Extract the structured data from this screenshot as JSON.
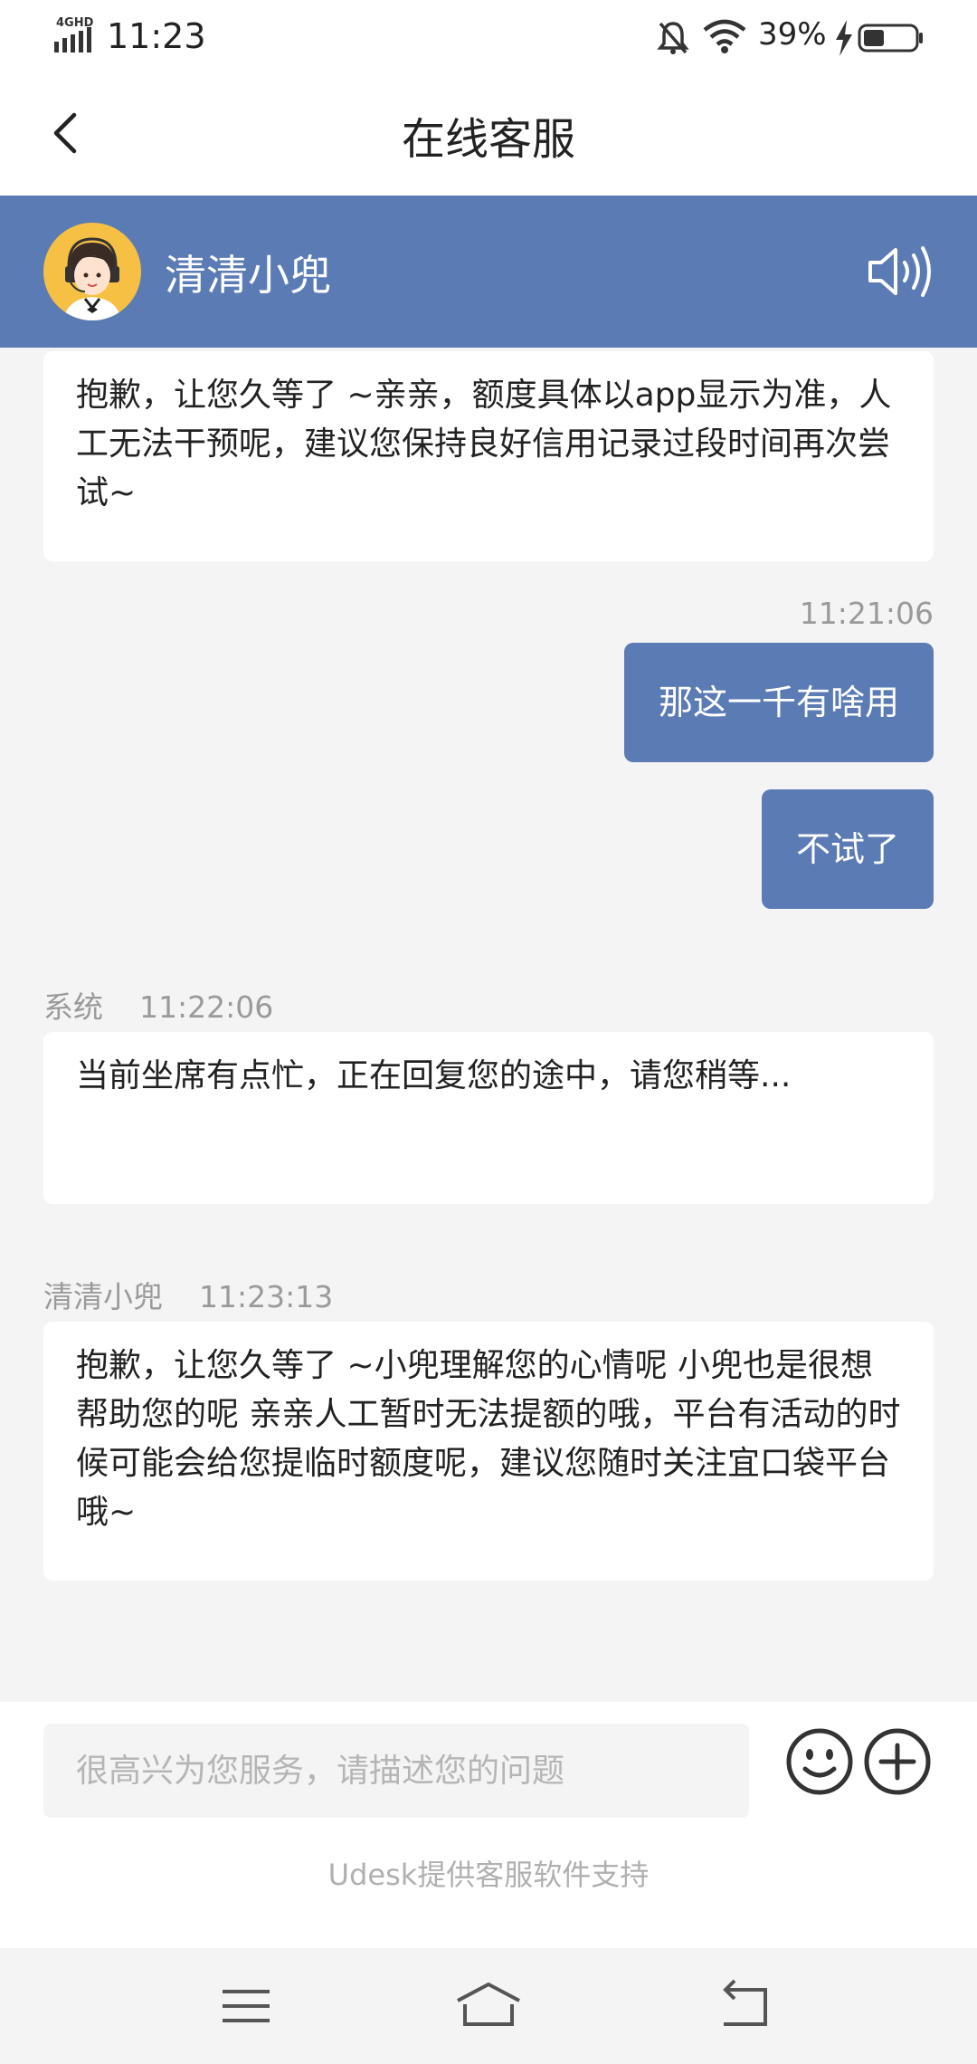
{
  "status_bar": {
    "network": "4GHD",
    "time": "11:23",
    "battery_percent": "39%",
    "icons": [
      "signal-icon",
      "mute-bell-icon",
      "wifi-icon",
      "charging-icon",
      "battery-icon"
    ]
  },
  "nav": {
    "title": "在线客服",
    "back_icon": "chevron-left-icon"
  },
  "agent": {
    "name": "清清小兜",
    "avatar_icon": "agent-avatar-icon",
    "sound_icon": "speaker-icon"
  },
  "messages": [
    {
      "direction": "in",
      "text": "抱歉，让您久等了 ~亲亲，额度具体以app显示为准，人工无法干预呢，建议您保持良好信用记录过段时间再次尝试~"
    },
    {
      "direction": "out",
      "time": "11:21:06",
      "text": "那这一千有啥用"
    },
    {
      "direction": "out",
      "text": "不试了"
    },
    {
      "direction": "in",
      "sender": "系统",
      "time": "11:22:06",
      "text": "当前坐席有点忙，正在回复您的途中，请您稍等..."
    },
    {
      "direction": "in",
      "sender": "清清小兜",
      "time": "11:23:13",
      "text": "抱歉，让您久等了 ~小兜理解您的心情呢 小兜也是很想帮助您的呢 亲亲人工暂时无法提额的哦，平台有活动的时候可能会给您提临时额度呢，建议您随时关注宜口袋平台哦~"
    }
  ],
  "input": {
    "placeholder": "很高兴为您服务，请描述您的问题",
    "value": "",
    "emoji_icon": "emoji-icon",
    "plus_icon": "plus-circle-icon"
  },
  "footer": {
    "powered_by": "Udesk提供客服软件支持"
  },
  "system_nav": [
    "menu-icon",
    "home-icon",
    "back-icon"
  ],
  "colors": {
    "accent": "#5b7bb5",
    "background": "#f4f4f5",
    "avatar_bg": "#f6c045"
  }
}
